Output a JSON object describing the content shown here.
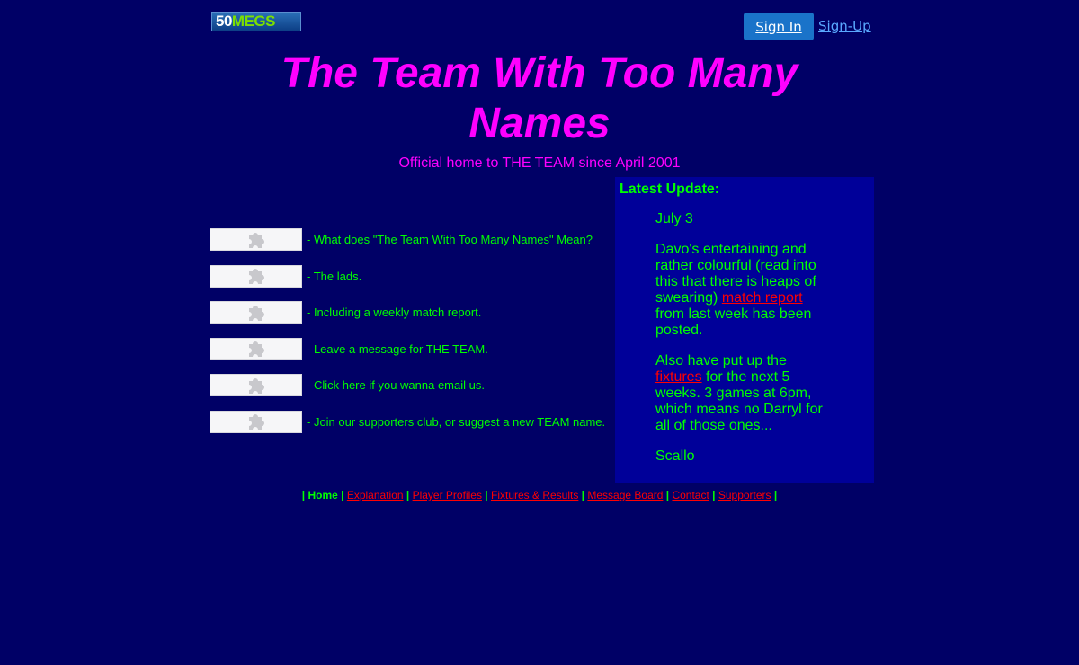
{
  "header": {
    "logo_num": "50",
    "logo_word": "MEGS",
    "signin_label": "Sign In",
    "signup_label": "Sign-Up"
  },
  "title": "The Team With Too Many Names",
  "subtitle": "Official home to THE TEAM since April 2001",
  "nav_items": [
    {
      "icon": "puzzle-icon",
      "text": "- What does \"The Team With Too Many Names\" Mean?"
    },
    {
      "icon": "puzzle-icon",
      "text": "- The lads."
    },
    {
      "icon": "puzzle-icon",
      "text": "- Including a weekly match report."
    },
    {
      "icon": "puzzle-icon",
      "text": "- Leave a message for THE TEAM."
    },
    {
      "icon": "puzzle-icon",
      "text": "- Click here if you wanna email us."
    },
    {
      "icon": "puzzle-icon",
      "text": "- Join our supporters club, or suggest a new TEAM name."
    }
  ],
  "update": {
    "heading": "Latest Update:",
    "date": "July 3",
    "para1_before": "Davo's entertaining and rather colourful (read into this that there is heaps of swearing) ",
    "para1_link": "match report",
    "para1_after": " from last week has been posted.",
    "para2_before": "Also have put up the ",
    "para2_link": "fixtures",
    "para2_after": " for the next 5 weeks. 3 games at 6pm, which means no Darryl for all of those ones...",
    "signature": "Scallo"
  },
  "footer": {
    "current": "Home",
    "links": [
      "Explanation",
      "Player Profiles",
      "Fixtures & Results",
      "Message Board",
      "Contact",
      "Supporters"
    ]
  },
  "colors": {
    "background": "#000066",
    "panel": "#000099",
    "title": "#ff00ff",
    "text": "#00ff00",
    "link": "#ff0000",
    "signin": "#1a73c9"
  }
}
